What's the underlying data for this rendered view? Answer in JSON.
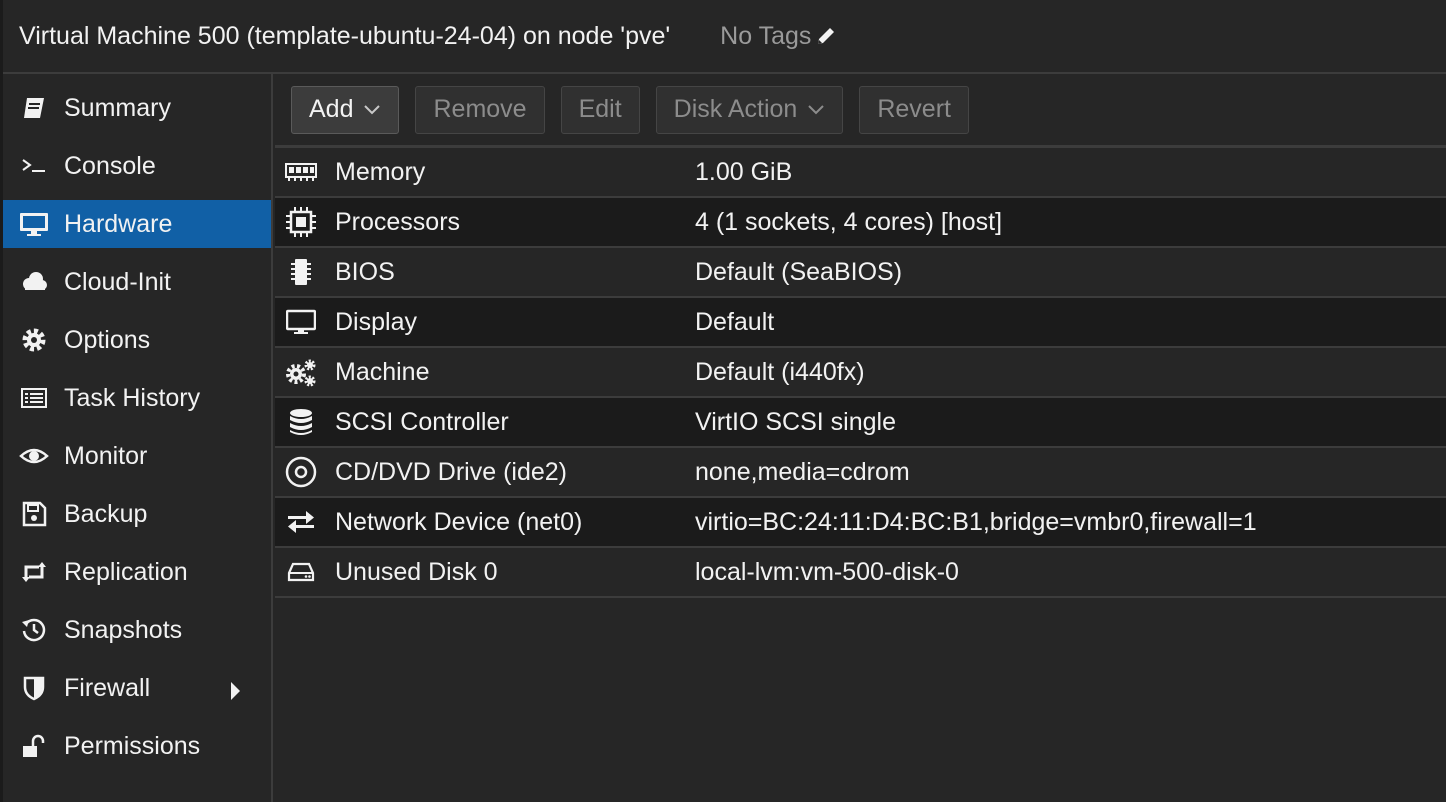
{
  "header": {
    "title": "Virtual Machine 500 (template-ubuntu-24-04) on node 'pve'",
    "tags_label": "No Tags",
    "tags_icon": "pencil-icon"
  },
  "sidebar": {
    "items": [
      {
        "label": "Summary",
        "icon": "book-icon"
      },
      {
        "label": "Console",
        "icon": "terminal-icon"
      },
      {
        "label": "Hardware",
        "icon": "desktop-icon",
        "active": true
      },
      {
        "label": "Cloud-Init",
        "icon": "cloud-icon"
      },
      {
        "label": "Options",
        "icon": "gear-icon"
      },
      {
        "label": "Task History",
        "icon": "list-icon"
      },
      {
        "label": "Monitor",
        "icon": "eye-icon"
      },
      {
        "label": "Backup",
        "icon": "floppy-icon"
      },
      {
        "label": "Replication",
        "icon": "retweet-icon"
      },
      {
        "label": "Snapshots",
        "icon": "history-icon"
      },
      {
        "label": "Firewall",
        "icon": "shield-icon",
        "has_submenu": true
      },
      {
        "label": "Permissions",
        "icon": "unlock-icon"
      }
    ]
  },
  "toolbar": {
    "add_label": "Add",
    "remove_label": "Remove",
    "edit_label": "Edit",
    "disk_action_label": "Disk Action",
    "revert_label": "Revert"
  },
  "hardware": {
    "rows": [
      {
        "name": "Memory",
        "value": "1.00 GiB",
        "icon": "memory-icon"
      },
      {
        "name": "Processors",
        "value": "4 (1 sockets, 4 cores) [host]",
        "icon": "cpu-icon"
      },
      {
        "name": "BIOS",
        "value": "Default (SeaBIOS)",
        "icon": "microchip-icon"
      },
      {
        "name": "Display",
        "value": "Default",
        "icon": "desktop-icon"
      },
      {
        "name": "Machine",
        "value": "Default (i440fx)",
        "icon": "cogs-icon"
      },
      {
        "name": "SCSI Controller",
        "value": "VirtIO SCSI single",
        "icon": "database-icon"
      },
      {
        "name": "CD/DVD Drive (ide2)",
        "value": "none,media=cdrom",
        "icon": "cdrom-icon"
      },
      {
        "name": "Network Device (net0)",
        "value": "virtio=BC:24:11:D4:BC:B1,bridge=vmbr0,firewall=1",
        "icon": "exchange-icon"
      },
      {
        "name": "Unused Disk 0",
        "value": "local-lvm:vm-500-disk-0",
        "icon": "hdd-icon"
      }
    ]
  },
  "colors": {
    "background": "#262626",
    "active_nav": "#1160a6",
    "alt_row": "#1b1b1b",
    "border": "#3c3c3c",
    "text": "#f2f2f2",
    "muted": "#8c8c8c"
  }
}
